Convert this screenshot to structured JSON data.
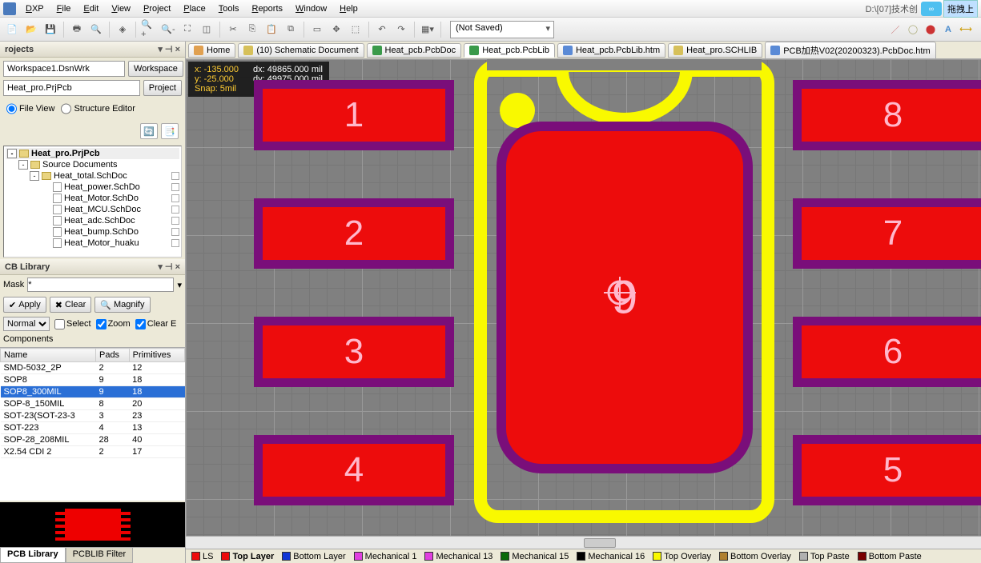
{
  "menu": {
    "app": "DXP",
    "items": [
      "File",
      "Edit",
      "View",
      "Project",
      "Place",
      "Tools",
      "Reports",
      "Window",
      "Help"
    ],
    "path": "D:\\[07]技术创",
    "drag_hint": "拖拽上"
  },
  "toolbar": {
    "saved_state": "(Not Saved)"
  },
  "projects": {
    "title": "rojects",
    "workspace": "Workspace1.DsnWrk",
    "workspace_btn": "Workspace",
    "project": "Heat_pro.PrjPcb",
    "project_btn": "Project",
    "view_file": "File View",
    "view_struct": "Structure Editor",
    "tree": [
      {
        "lvl": 0,
        "exp": "-",
        "type": "prj",
        "label": "Heat_pro.PrjPcb",
        "bold": true
      },
      {
        "lvl": 1,
        "exp": "-",
        "type": "fld",
        "label": "Source Documents"
      },
      {
        "lvl": 2,
        "exp": "-",
        "type": "fld",
        "label": "Heat_total.SchDoc",
        "pin": true
      },
      {
        "lvl": 3,
        "exp": "",
        "type": "doc",
        "label": "Heat_power.SchDo",
        "pin": true
      },
      {
        "lvl": 3,
        "exp": "",
        "type": "doc",
        "label": "Heat_Motor.SchDo",
        "pin": true
      },
      {
        "lvl": 3,
        "exp": "",
        "type": "doc",
        "label": "Heat_MCU.SchDoc",
        "pin": true
      },
      {
        "lvl": 3,
        "exp": "",
        "type": "doc",
        "label": "Heat_adc.SchDoc",
        "pin": true
      },
      {
        "lvl": 3,
        "exp": "",
        "type": "doc",
        "label": "Heat_bump.SchDo",
        "pin": true
      },
      {
        "lvl": 3,
        "exp": "",
        "type": "doc",
        "label": "Heat_Motor_huaku",
        "pin": true
      }
    ]
  },
  "library": {
    "title": "CB Library",
    "mask_label": "Mask",
    "mask_value": "*",
    "apply": "Apply",
    "clear": "Clear",
    "magnify": "Magnify",
    "normal": "Normal",
    "select": "Select",
    "zoom": "Zoom",
    "clear_e": "Clear E",
    "comp_header": "Components",
    "cols": [
      "Name",
      "Pads",
      "Primitives"
    ],
    "rows": [
      {
        "n": "SMD-5032_2P",
        "p": "2",
        "pr": "12"
      },
      {
        "n": "SOP8",
        "p": "9",
        "pr": "18"
      },
      {
        "n": "SOP8_300MIL",
        "p": "9",
        "pr": "18",
        "sel": true
      },
      {
        "n": "SOP-8_150MIL",
        "p": "8",
        "pr": "20"
      },
      {
        "n": "SOT-23(SOT-23-3",
        "p": "3",
        "pr": "23"
      },
      {
        "n": "SOT-223",
        "p": "4",
        "pr": "13"
      },
      {
        "n": "SOP-28_208MIL",
        "p": "28",
        "pr": "40"
      },
      {
        "n": "X2.54 CDI 2",
        "p": "2",
        "pr": "17"
      }
    ],
    "tabs": [
      "PCB Library",
      "PCBLIB Filter"
    ]
  },
  "doctabs": [
    {
      "ico": "home",
      "label": "Home"
    },
    {
      "ico": "sch",
      "label": "(10) Schematic Document"
    },
    {
      "ico": "pcb",
      "label": "Heat_pcb.PcbDoc"
    },
    {
      "ico": "pcb",
      "label": "Heat_pcb.PcbLib",
      "active": true
    },
    {
      "ico": "htm",
      "label": "Heat_pcb.PcbLib.htm"
    },
    {
      "ico": "sch",
      "label": "Heat_pro.SCHLIB"
    },
    {
      "ico": "htm",
      "label": "PCB加热V02(20200323).PcbDoc.htm"
    }
  ],
  "coords": {
    "x": "x:  -135.000",
    "y": "y:   -25.000",
    "snap": "Snap: 5mil",
    "dx": "dx: 49865.000  mil",
    "dy": "dy: 49975.000  mil"
  },
  "pads": {
    "left": [
      {
        "n": "1"
      },
      {
        "n": "2"
      },
      {
        "n": "3"
      },
      {
        "n": "4"
      }
    ],
    "right": [
      {
        "n": "8"
      },
      {
        "n": "7"
      },
      {
        "n": "6"
      },
      {
        "n": "5"
      }
    ],
    "center": "9"
  },
  "layers": [
    {
      "c": "#ed0c0c",
      "t": "LS"
    },
    {
      "c": "#ed0c0c",
      "t": "Top Layer",
      "b": true
    },
    {
      "c": "#1036d6",
      "t": "Bottom Layer"
    },
    {
      "c": "#e040e0",
      "t": "Mechanical 1"
    },
    {
      "c": "#e040e0",
      "t": "Mechanical 13"
    },
    {
      "c": "#0a6a0a",
      "t": "Mechanical 15"
    },
    {
      "c": "#000000",
      "t": "Mechanical 16"
    },
    {
      "c": "#f9f900",
      "t": "Top Overlay"
    },
    {
      "c": "#b08030",
      "t": "Bottom Overlay"
    },
    {
      "c": "#b0b0b0",
      "t": "Top Paste"
    },
    {
      "c": "#7a0000",
      "t": "Bottom Paste"
    }
  ]
}
